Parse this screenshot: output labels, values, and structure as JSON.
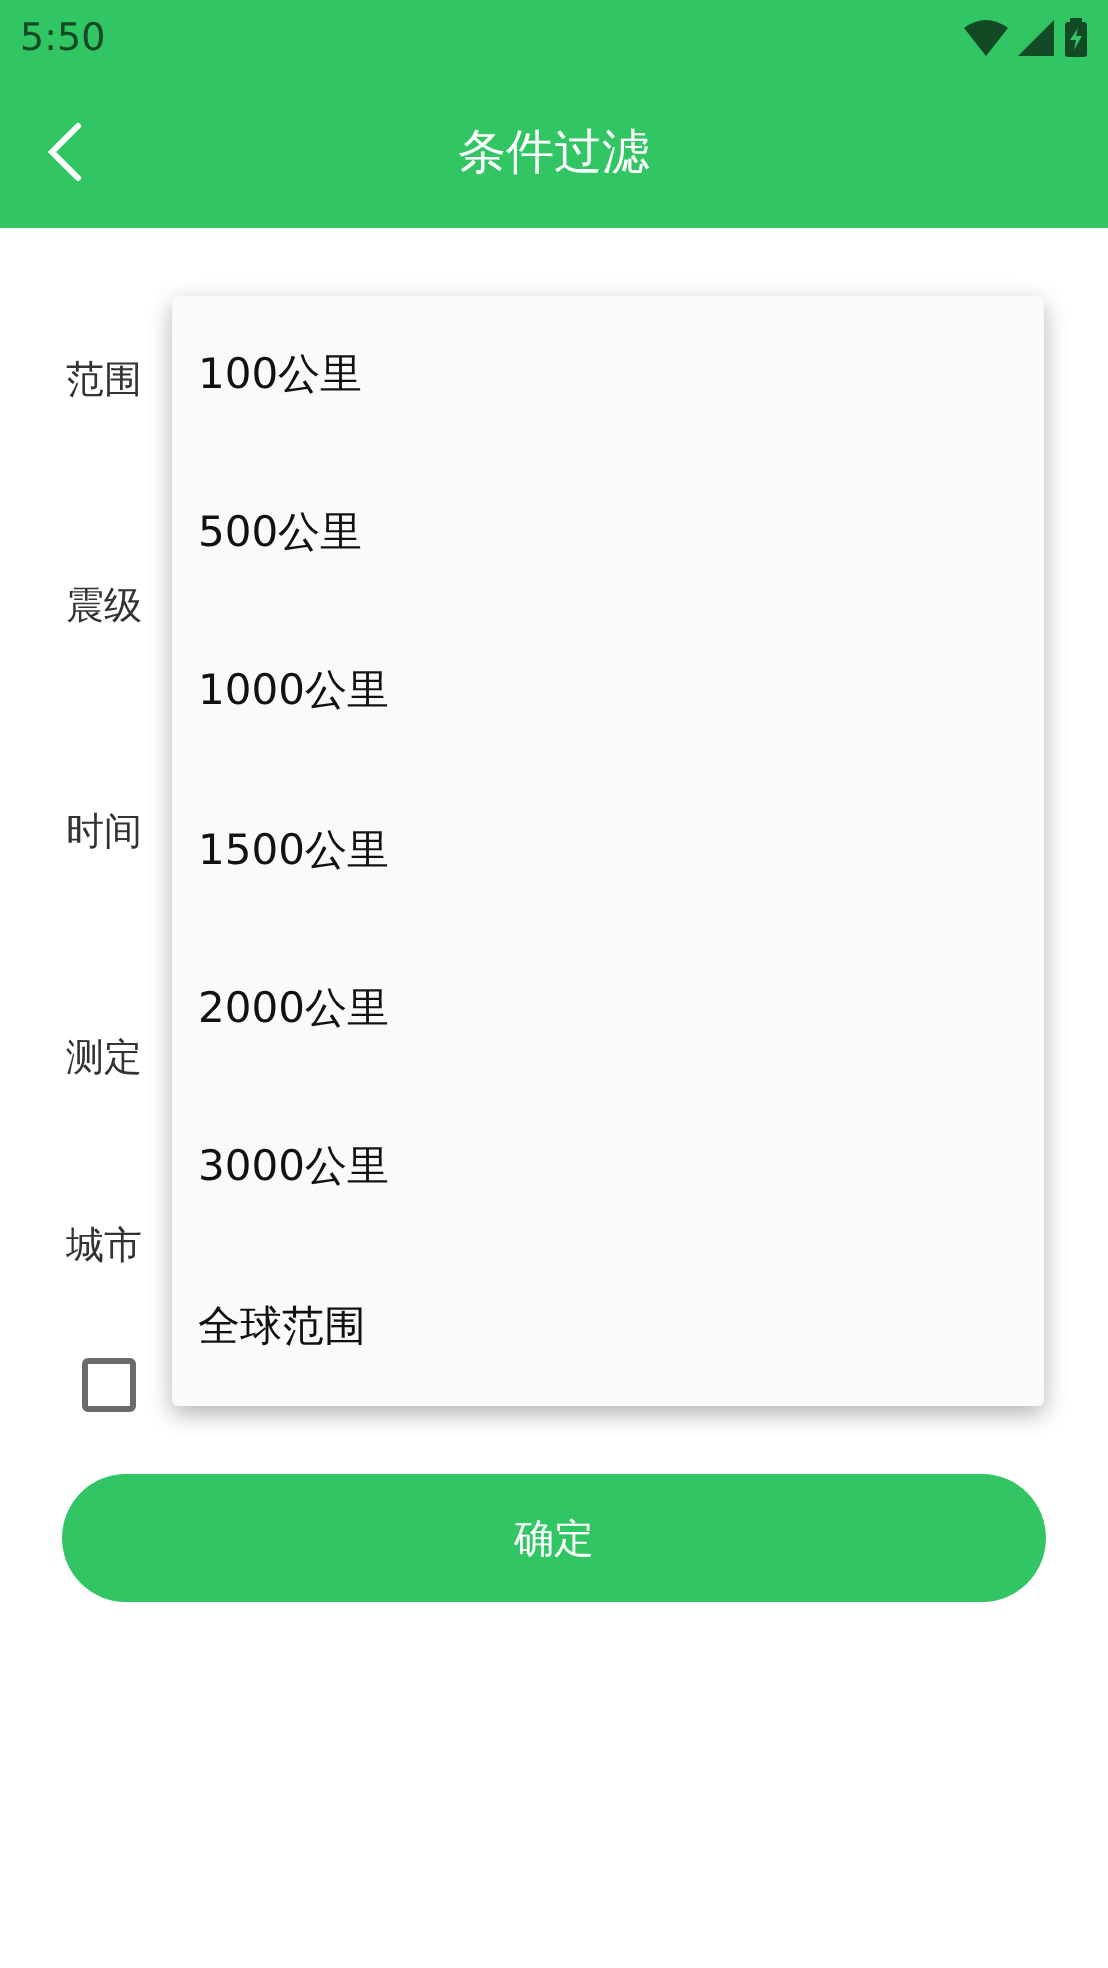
{
  "status_bar": {
    "time": "5:50"
  },
  "app_bar": {
    "title": "条件过滤"
  },
  "form": {
    "fields": [
      {
        "label": "范围"
      },
      {
        "label": "震级"
      },
      {
        "label": "时间"
      },
      {
        "label": "测定"
      },
      {
        "label": "城市"
      }
    ],
    "checkbox": {
      "checked": false
    },
    "submit": "确定"
  },
  "dropdown_menu": {
    "items": [
      {
        "label": "100公里"
      },
      {
        "label": "500公里"
      },
      {
        "label": "1000公里"
      },
      {
        "label": "1500公里"
      },
      {
        "label": "2000公里"
      },
      {
        "label": "3000公里"
      },
      {
        "label": "全球范围"
      }
    ]
  }
}
